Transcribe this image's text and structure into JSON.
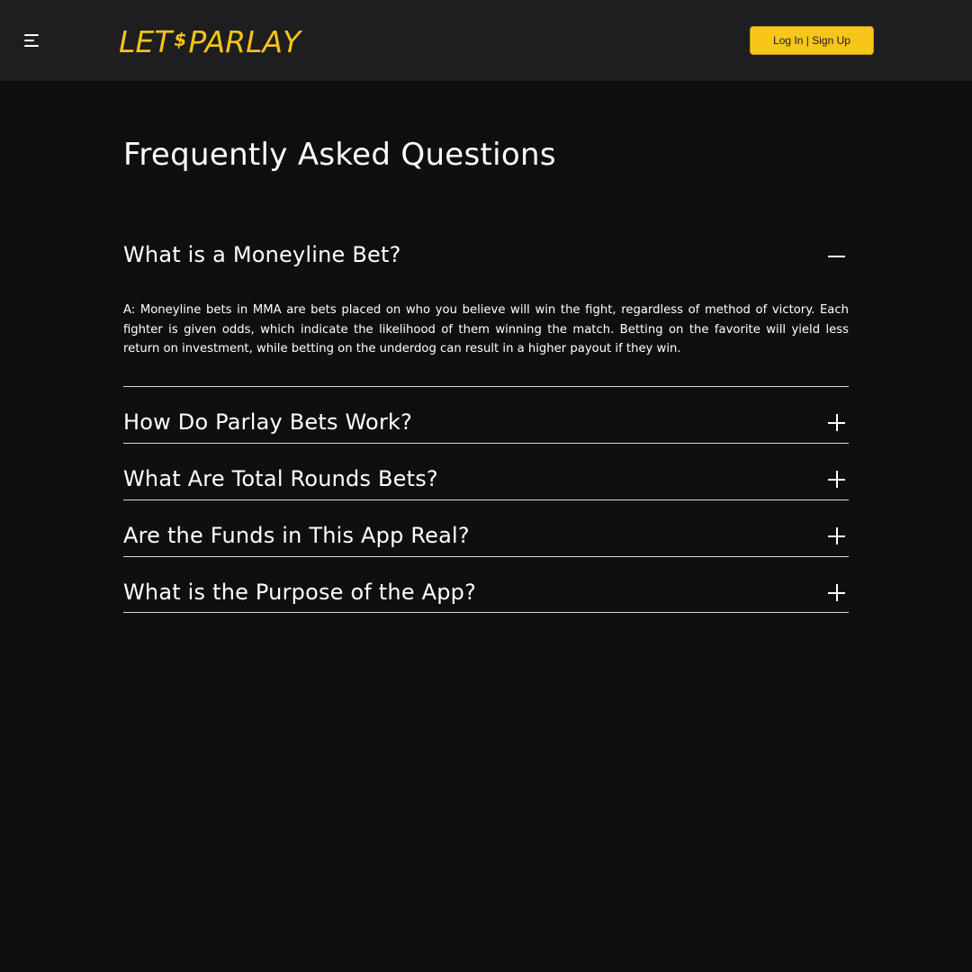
{
  "header": {
    "menu_icon": "hamburger-menu-icon",
    "logo": {
      "left": "LET",
      "symbol": "$",
      "right": "PARLAY"
    },
    "auth_button_label": "Log In | Sign Up",
    "brand_color": "#f2c21a"
  },
  "faq": {
    "title": "Frequently Asked Questions",
    "items": [
      {
        "question": "What is a Moneyline Bet?",
        "answer": "A: Moneyline bets in MMA are bets placed on who you believe will win the fight, regardless of method of victory. Each fighter is given odds, which indicate the likelihood of them winning the match. Betting on the favorite will yield less return on investment, while betting on the underdog can result in a higher payout if they win.",
        "expanded": true,
        "toggle_icon": "minus-icon"
      },
      {
        "question": "How Do Parlay Bets Work?",
        "expanded": false,
        "toggle_icon": "plus-icon"
      },
      {
        "question": "What Are Total Rounds Bets?",
        "expanded": false,
        "toggle_icon": "plus-icon"
      },
      {
        "question": "Are the Funds in This App Real?",
        "expanded": false,
        "toggle_icon": "plus-icon"
      },
      {
        "question": "What is the Purpose of the App?",
        "expanded": false,
        "toggle_icon": "plus-icon"
      }
    ]
  }
}
